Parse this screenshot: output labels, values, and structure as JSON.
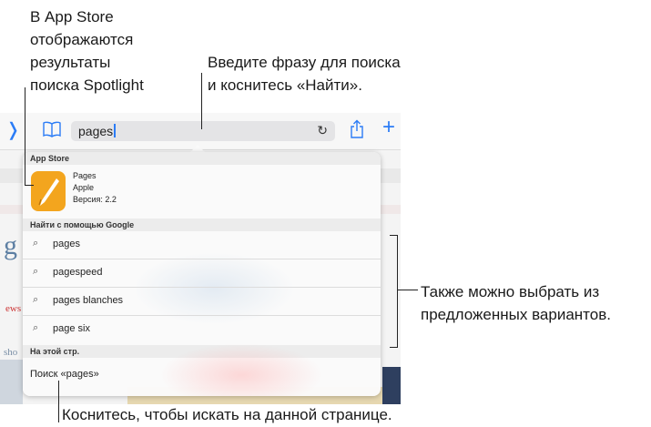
{
  "callouts": {
    "app_store": [
      "В App Store",
      "отображаются",
      "результаты",
      "поиска Spotlight"
    ],
    "enter_phrase": [
      "Введите фразу для поиска",
      "и коснитесь «Найти»."
    ],
    "also_choose": [
      "Также можно выбрать из",
      "предложенных вариантов."
    ],
    "search_page": "Коснитесь, чтобы искать на данной странице."
  },
  "url_field": {
    "value": "pages"
  },
  "icons": {
    "back": "chevron-left-icon",
    "bookmarks": "book-icon",
    "reload": "reload-icon",
    "share": "share-icon",
    "new_tab": "plus-icon",
    "search": "search-icon"
  },
  "popover": {
    "app_store_section": "App Store",
    "app": {
      "name": "Pages",
      "developer": "Apple",
      "version": "Версия: 2.2"
    },
    "google_section": "Найти с помощью Google",
    "suggestions": [
      "pages",
      "pagespeed",
      "pages blanches",
      "page six"
    ],
    "on_page_section": "На этой стр.",
    "find_on_page": "Поиск «pages»"
  },
  "colors": {
    "accent": "#2b7cf6",
    "app_icon": "#f3a51e"
  }
}
